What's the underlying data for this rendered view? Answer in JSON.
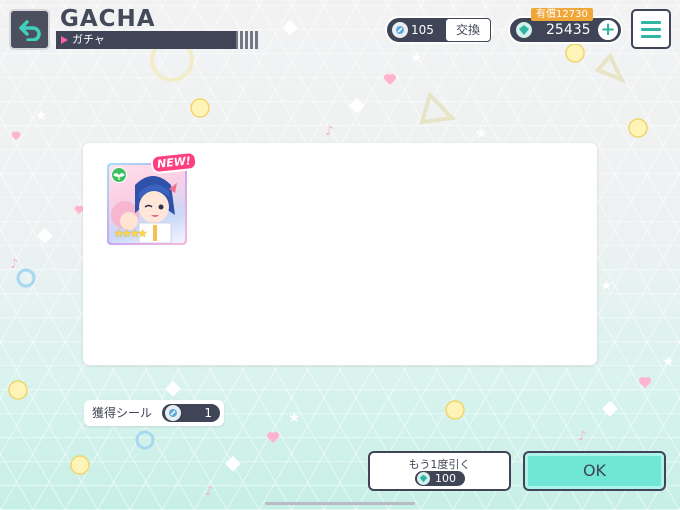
{
  "header": {
    "title": "GACHA",
    "subtitle": "ガチャ"
  },
  "currency": {
    "shard_count": "105",
    "exchange_label": "交換",
    "paid_badge": "有償12730",
    "crystal_count": "25435",
    "plus_label": "+"
  },
  "result": {
    "new_badge": "NEW!",
    "card_stars": "★★★★",
    "card_attribute": "green"
  },
  "sticker": {
    "label": "獲得シール",
    "count": "1"
  },
  "actions": {
    "again_label": "もう1度引く",
    "again_cost": "100",
    "ok_label": "OK"
  },
  "colors": {
    "dark": "#3f4456",
    "accent_teal": "#2fb5a3",
    "ok_fill": "#6fe6d6",
    "new_pink": "#ff3f7e",
    "paid_orange": "#f0a73a"
  }
}
